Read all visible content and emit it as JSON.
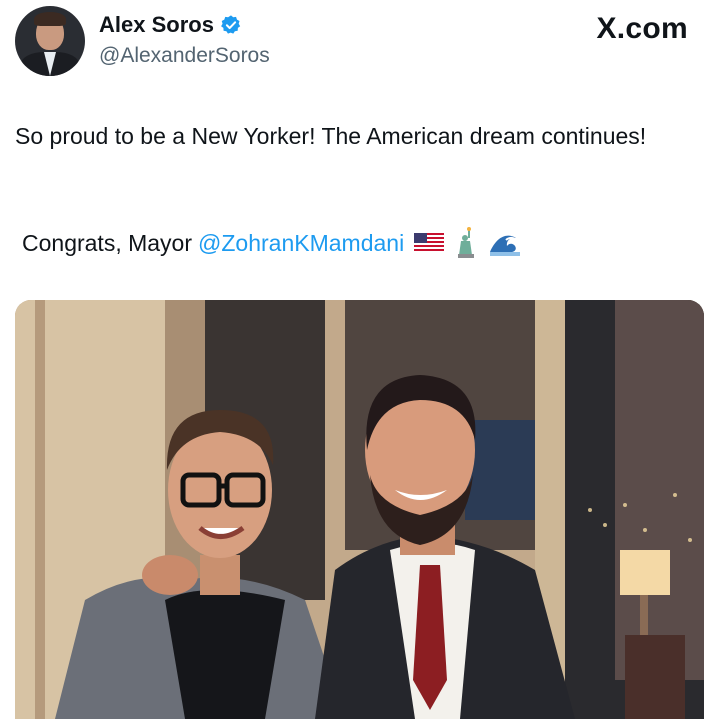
{
  "author": {
    "display_name": "Alex Soros",
    "handle": "@AlexanderSoros",
    "verified": true
  },
  "brand": {
    "label": "X.com"
  },
  "tweet": {
    "text": "So proud to be a New Yorker! The American dream continues!",
    "congrats_prefix": "Congrats, Mayor",
    "mention": "@ZohranKMamdani",
    "emojis": [
      "us-flag-icon",
      "statue-of-liberty-icon",
      "wave-icon"
    ]
  },
  "colors": {
    "text": "#0f1419",
    "secondary": "#536471",
    "link": "#1d9bf0",
    "verified": "#1d9bf0"
  }
}
